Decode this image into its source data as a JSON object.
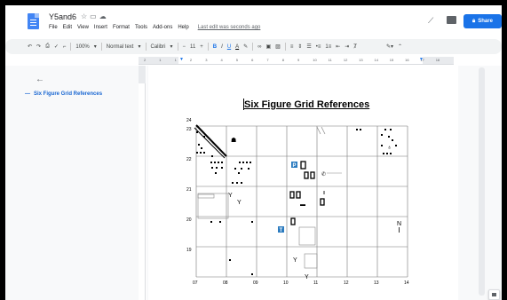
{
  "document": {
    "title": "Y5and6",
    "menu": [
      "File",
      "Edit",
      "View",
      "Insert",
      "Format",
      "Tools",
      "Add-ons",
      "Help"
    ],
    "last_edit": "Last edit was seconds ago",
    "share_label": "Share"
  },
  "toolbar": {
    "zoom": "100%",
    "style": "Normal text",
    "font": "Calibri",
    "font_size": "11",
    "bold": "B",
    "italic": "I",
    "underline": "U",
    "text_color": "A"
  },
  "ruler": {
    "numbers": [
      "2",
      "1",
      "1",
      "2",
      "3",
      "4",
      "5",
      "6",
      "7",
      "8",
      "9",
      "10",
      "11",
      "12",
      "13",
      "14",
      "15",
      "16",
      "17",
      "18"
    ]
  },
  "outline": {
    "items": [
      {
        "label": "Six Figure Grid References"
      }
    ]
  },
  "page": {
    "heading": "Six Figure Grid References"
  },
  "grid_map": {
    "eastings": [
      "07",
      "08",
      "09",
      "10",
      "11",
      "12",
      "13",
      "14"
    ],
    "northings": [
      "24",
      "23",
      "22",
      "21",
      "20",
      "19"
    ],
    "symbol_labels": {
      "parking": "P",
      "phone": "T",
      "north": "N"
    }
  }
}
